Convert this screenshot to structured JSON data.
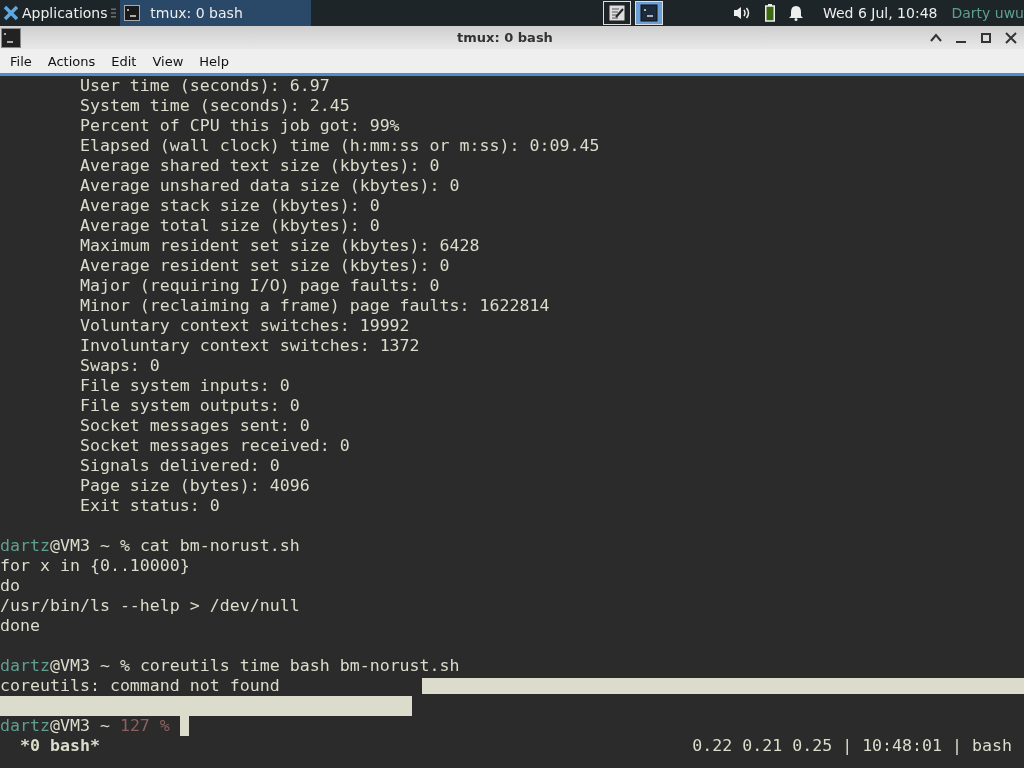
{
  "panel": {
    "apps_label": "Applications",
    "task": {
      "title": "tmux: 0 bash",
      "selected": true
    },
    "workspaces": [
      {
        "kind": "editor",
        "selected": false
      },
      {
        "kind": "terminal",
        "selected": true
      }
    ],
    "clock": "Wed  6 Jul, 10:48",
    "user": "Darty uwu"
  },
  "window": {
    "title": "tmux: 0 bash"
  },
  "menu": [
    "File",
    "Actions",
    "Edit",
    "View",
    "Help"
  ],
  "terminal": {
    "lines": [
      {
        "kind": "output",
        "text": "        User time (seconds): 6.97",
        "highlighted": false
      },
      {
        "kind": "output",
        "text": "        System time (seconds): 2.45",
        "highlighted": false
      },
      {
        "kind": "output",
        "text": "        Percent of CPU this job got: 99%",
        "highlighted": false
      },
      {
        "kind": "output",
        "text": "        Elapsed (wall clock) time (h:mm:ss or m:ss): 0:09.45",
        "highlighted": false
      },
      {
        "kind": "output",
        "text": "        Average shared text size (kbytes): 0",
        "highlighted": false
      },
      {
        "kind": "output",
        "text": "        Average unshared data size (kbytes): 0",
        "highlighted": false
      },
      {
        "kind": "output",
        "text": "        Average stack size (kbytes): 0",
        "highlighted": false
      },
      {
        "kind": "output",
        "text": "        Average total size (kbytes): 0",
        "highlighted": false
      },
      {
        "kind": "output",
        "text": "        Maximum resident set size (kbytes): 6428",
        "highlighted": false
      },
      {
        "kind": "output",
        "text": "        Average resident set size (kbytes): 0",
        "highlighted": false
      },
      {
        "kind": "output",
        "text": "        Major (requiring I/O) page faults: 0",
        "highlighted": false
      },
      {
        "kind": "output",
        "text": "        Minor (reclaiming a frame) page faults: 1622814",
        "highlighted": false
      },
      {
        "kind": "output",
        "text": "        Voluntary context switches: 19992",
        "highlighted": false
      },
      {
        "kind": "output",
        "text": "        Involuntary context switches: 1372",
        "highlighted": false
      },
      {
        "kind": "output",
        "text": "        Swaps: 0",
        "highlighted": false
      },
      {
        "kind": "output",
        "text": "        File system inputs: 0",
        "highlighted": false
      },
      {
        "kind": "output",
        "text": "        File system outputs: 0",
        "highlighted": false
      },
      {
        "kind": "output",
        "text": "        Socket messages sent: 0",
        "highlighted": false
      },
      {
        "kind": "output",
        "text": "        Socket messages received: 0",
        "highlighted": false
      },
      {
        "kind": "output",
        "text": "        Signals delivered: 0",
        "highlighted": false
      },
      {
        "kind": "output",
        "text": "        Page size (bytes): 4096",
        "highlighted": false
      },
      {
        "kind": "output",
        "text": "        Exit status: 0",
        "highlighted": false
      },
      {
        "kind": "blank",
        "highlighted": false
      },
      {
        "kind": "prompt",
        "user": "dartz",
        "host": "@VM3 ~",
        "symbol": "%",
        "command": "cat bm-norust.sh",
        "cursor": false
      },
      {
        "kind": "output",
        "text": "for x in {0..10000}",
        "highlighted": false
      },
      {
        "kind": "output",
        "text": "do",
        "highlighted": false
      },
      {
        "kind": "output",
        "text": "/usr/bin/ls --help > /dev/null",
        "highlighted": false
      },
      {
        "kind": "output",
        "text": "done",
        "highlighted": false
      },
      {
        "kind": "blank",
        "highlighted": false
      },
      {
        "kind": "prompt",
        "user": "dartz",
        "host": "@VM3 ~",
        "symbol": "%",
        "command": "coreutils time bash bm-norust.sh",
        "cursor": false
      },
      {
        "kind": "output",
        "text": "coreutils: command not found",
        "highlighted": true
      },
      {
        "kind": "blank",
        "highlighted": true
      },
      {
        "kind": "prompt",
        "user": "dartz",
        "host": "@VM3 ~",
        "exit_code": "127",
        "symbol": "%",
        "cursor": true
      }
    ]
  },
  "tmux_status": {
    "window": " *0 bash*",
    "right": "0.22 0.21 0.25 | 10:48:01 | bash"
  }
}
